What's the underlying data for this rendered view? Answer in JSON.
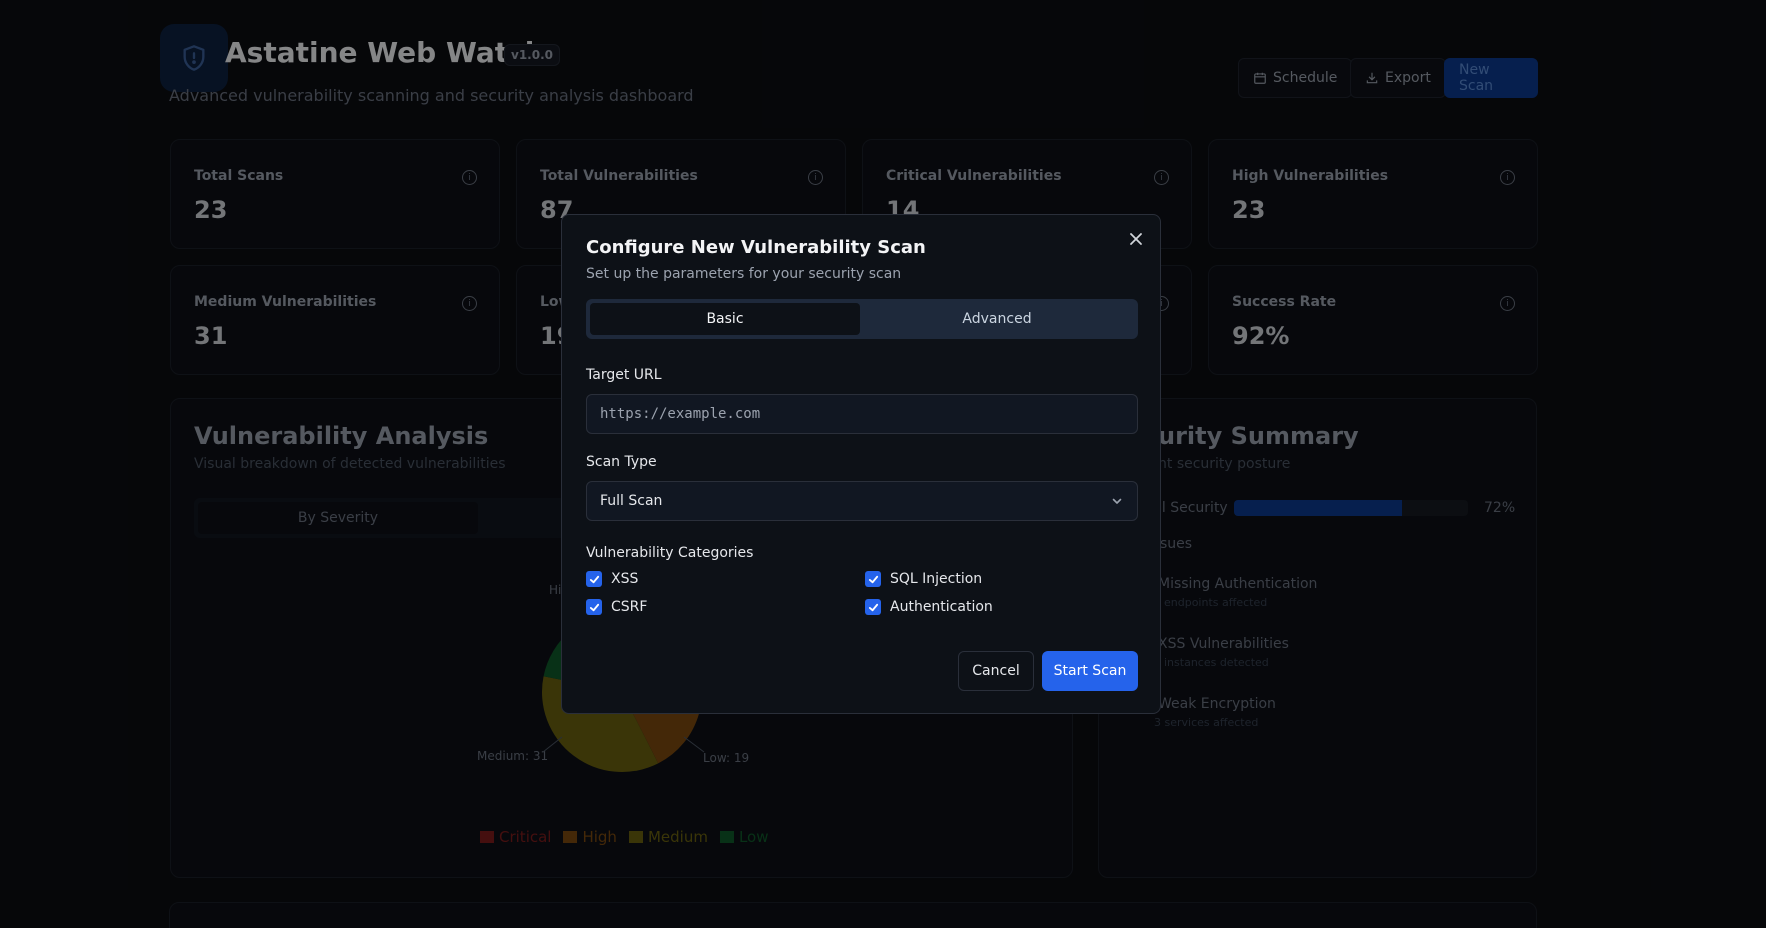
{
  "header": {
    "title": "Astatine Web Watch",
    "version": "v1.0.0",
    "subtitle": "Advanced vulnerability scanning and security analysis dashboard",
    "schedule_label": "Schedule",
    "export_label": "Export",
    "new_scan_label": "New Scan"
  },
  "stats": [
    {
      "label": "Total Scans",
      "value": "23"
    },
    {
      "label": "Total Vulnerabilities",
      "value": "87"
    },
    {
      "label": "Critical Vulnerabilities",
      "value": "14"
    },
    {
      "label": "High Vulnerabilities",
      "value": "23"
    },
    {
      "label": "Medium Vulnerabilities",
      "value": "31"
    },
    {
      "label": "Low",
      "value": "19"
    },
    {
      "label": "",
      "value": ""
    },
    {
      "label": "Success Rate",
      "value": "92%"
    }
  ],
  "analysis": {
    "title": "Vulnerability Analysis",
    "subtitle": "Visual breakdown of detected vulnerabilities",
    "tab_by_severity": "By Severity",
    "label_high": "Hi",
    "label_medium": "Medium: 31",
    "label_low": "Low: 19",
    "legend": [
      {
        "label": "Critical",
        "color": "#7f1d1d"
      },
      {
        "label": "High",
        "color": "#7c4a10"
      },
      {
        "label": "Medium",
        "color": "#6b6210"
      },
      {
        "label": "Low",
        "color": "#0f5a2a"
      }
    ]
  },
  "chart_data": {
    "type": "pie",
    "categories": [
      "Critical",
      "High",
      "Medium",
      "Low"
    ],
    "values": [
      14,
      23,
      31,
      19
    ],
    "colors": [
      "#7f1d1d",
      "#7c4a10",
      "#6b6210",
      "#0f5a2a"
    ]
  },
  "security": {
    "title": "urity Summary",
    "subtitle": "nt security posture",
    "overall_label": "ll Security",
    "overall_value": "72%",
    "overall_fraction": 0.72,
    "issues_label": "sues",
    "issues": [
      {
        "title": "Missing Authentication",
        "sub": "endpoints affected"
      },
      {
        "title": "XSS Vulnerabilities",
        "sub": "instances detected"
      },
      {
        "title": "Weak Encryption",
        "sub": "3 services affected"
      }
    ]
  },
  "modal": {
    "title": "Configure New Vulnerability Scan",
    "subtitle": "Set up the parameters for your security scan",
    "tab_basic": "Basic",
    "tab_advanced": "Advanced",
    "target_label": "Target URL",
    "target_placeholder": "https://example.com",
    "scan_type_label": "Scan Type",
    "scan_type_value": "Full Scan",
    "categories_label": "Vulnerability Categories",
    "categories": [
      "XSS",
      "SQL Injection",
      "CSRF",
      "Authentication"
    ],
    "cancel_label": "Cancel",
    "start_label": "Start Scan"
  }
}
